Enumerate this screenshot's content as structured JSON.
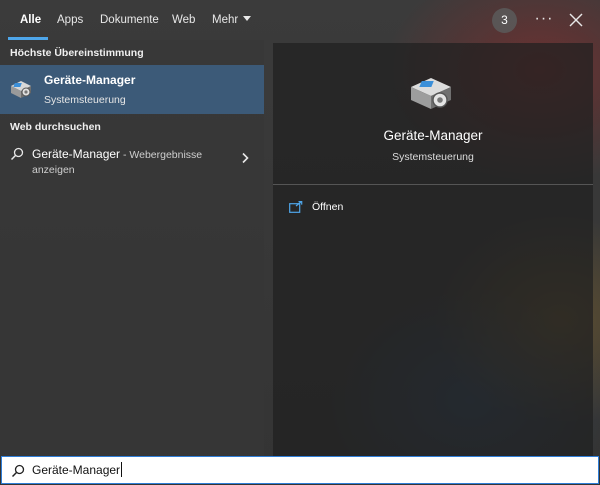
{
  "tabs": [
    {
      "label": "Alle",
      "active": true
    },
    {
      "label": "Apps",
      "active": false
    },
    {
      "label": "Dokumente",
      "active": false
    },
    {
      "label": "Web",
      "active": false
    },
    {
      "label": "Mehr",
      "active": false
    }
  ],
  "header": {
    "badge_count": "3",
    "more_label": "···",
    "close_icon": "close-icon"
  },
  "results": {
    "best_match_heading": "Höchste Übereinstimmung",
    "best_match": {
      "title": "Geräte-Manager",
      "subtitle": "Systemsteuerung",
      "icon": "device-manager-icon"
    },
    "web_heading": "Web durchsuchen",
    "web_item": {
      "title": "Geräte-Manager",
      "suffix": " - Webergebnisse",
      "line2": "anzeigen",
      "icon": "search-icon"
    }
  },
  "preview": {
    "title": "Geräte-Manager",
    "subtitle": "Systemsteuerung",
    "actions": [
      {
        "label": "Öffnen",
        "icon": "open-icon"
      }
    ]
  },
  "search": {
    "value": "Geräte-Manager"
  },
  "colors": {
    "accent": "#4ea6ea",
    "selection": "#3c5a78",
    "search_border": "#2f7ed8"
  }
}
